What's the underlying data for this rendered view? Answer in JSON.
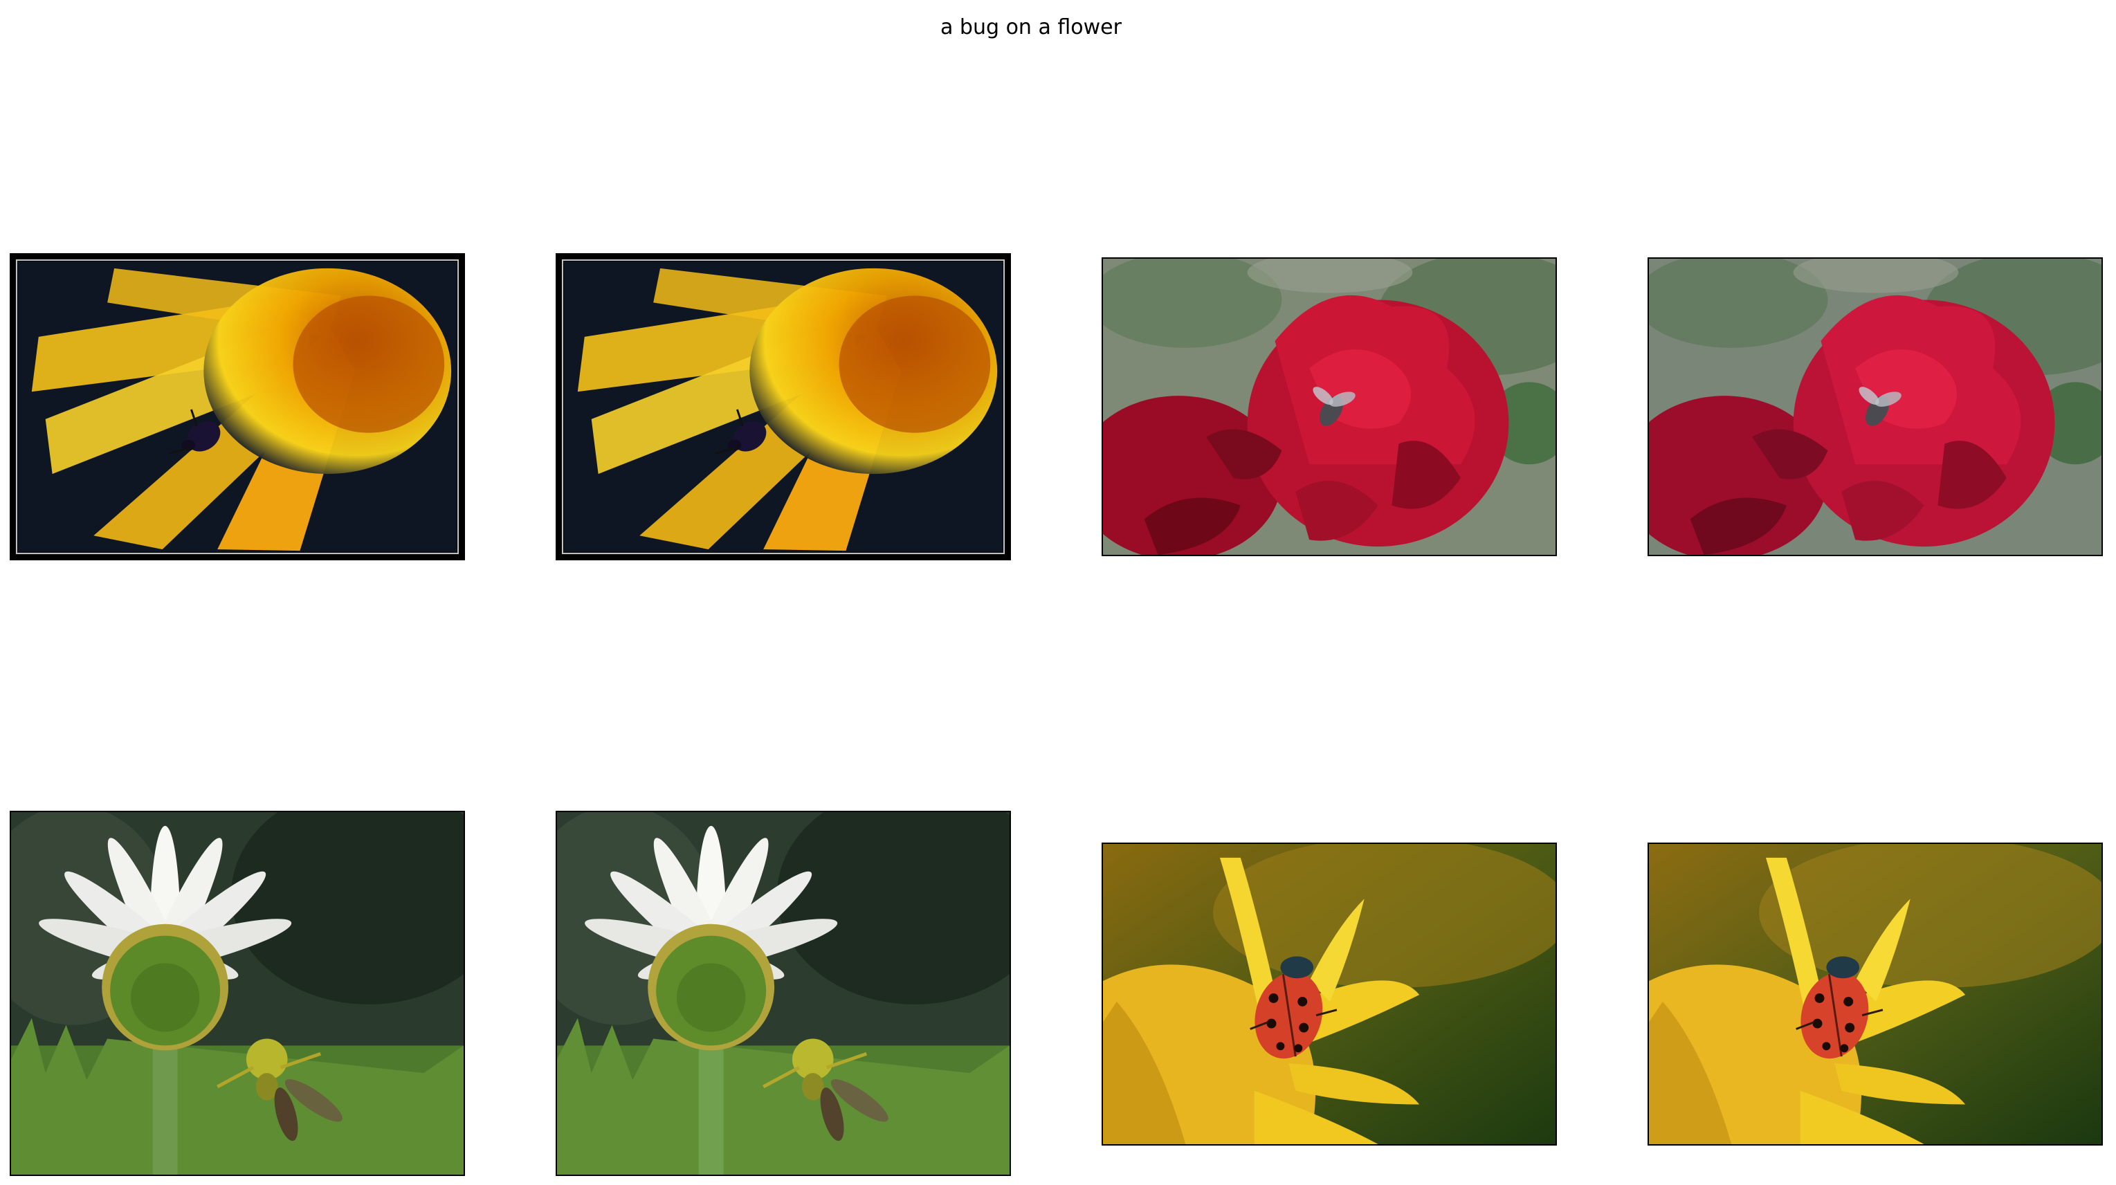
{
  "figure": {
    "title": "a bug on a flower"
  },
  "images": [
    {
      "subject": "dark beetle on orange-yellow dandelion, black frame"
    },
    {
      "subject": "dark beetle on orange-yellow dandelion, black frame"
    },
    {
      "subject": "fly on red rose"
    },
    {
      "subject": "fly on red rose"
    },
    {
      "subject": "crab spider with insect under white daisy"
    },
    {
      "subject": "crab spider with insect under white daisy"
    },
    {
      "subject": "ladybug on yellow flower"
    },
    {
      "subject": "ladybug on yellow flower"
    }
  ]
}
